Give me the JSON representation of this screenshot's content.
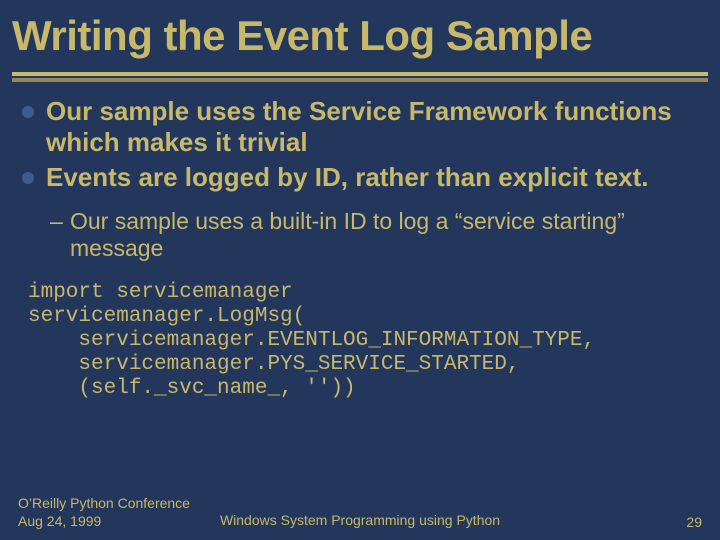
{
  "title": "Writing the Event Log Sample",
  "bullets": [
    "Our sample uses the Service Framework functions which makes it trivial",
    "Events are logged by ID, rather than explicit text."
  ],
  "sub_bullets": [
    "Our sample uses a built-in ID to log a “service starting” message"
  ],
  "code": "import servicemanager\nservicemanager.LogMsg(\n    servicemanager.EVENTLOG_INFORMATION_TYPE,\n    servicemanager.PYS_SERVICE_STARTED,\n    (self._svc_name_, ''))",
  "footer": {
    "left_line1": "O’Reilly Python Conference",
    "left_line2": "Aug 24, 1999",
    "center": "Windows System Programming using Python",
    "page": "29"
  }
}
